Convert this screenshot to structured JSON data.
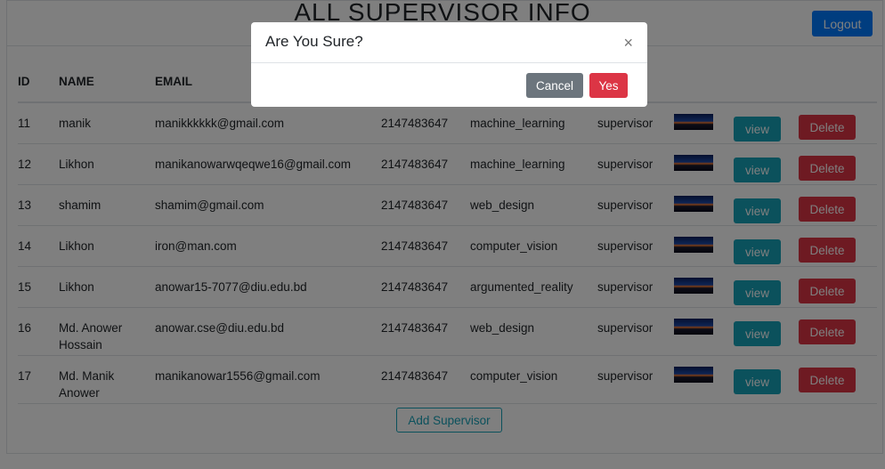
{
  "page": {
    "title": "ALL SUPERVISOR INFO",
    "logout_label": "Logout",
    "add_label": "Add Supervisor"
  },
  "table": {
    "headers": [
      "ID",
      "NAME",
      "EMAIL",
      "",
      "",
      "",
      "",
      "",
      ""
    ],
    "rows": [
      {
        "id": "11",
        "name": "manik",
        "email": "manikkkkkk@gmail.com",
        "phone": "2147483647",
        "area": "machine_learning",
        "role": "supervisor",
        "view": "view",
        "delete": "Delete"
      },
      {
        "id": "12",
        "name": "Likhon",
        "email": "manikanowarwqeqwe16@gmail.com",
        "phone": "2147483647",
        "area": "machine_learning",
        "role": "supervisor",
        "view": "view",
        "delete": "Delete"
      },
      {
        "id": "13",
        "name": "shamim",
        "email": "shamim@gmail.com",
        "phone": "2147483647",
        "area": "web_design",
        "role": "supervisor",
        "view": "view",
        "delete": "Delete"
      },
      {
        "id": "14",
        "name": "Likhon",
        "email": "iron@man.com",
        "phone": "2147483647",
        "area": "computer_vision",
        "role": "supervisor",
        "view": "view",
        "delete": "Delete"
      },
      {
        "id": "15",
        "name": "Likhon",
        "email": "anowar15-7077@diu.edu.bd",
        "phone": "2147483647",
        "area": "argumented_reality",
        "role": "supervisor",
        "view": "view",
        "delete": "Delete"
      },
      {
        "id": "16",
        "name": "Md. Anower Hossain",
        "email": "anowar.cse@diu.edu.bd",
        "phone": "2147483647",
        "area": "web_design",
        "role": "supervisor",
        "view": "view",
        "delete": "Delete"
      },
      {
        "id": "17",
        "name": "Md. Manik Anower",
        "email": "manikanowar1556@gmail.com",
        "phone": "2147483647",
        "area": "computer_vision",
        "role": "supervisor",
        "view": "view",
        "delete": "Delete"
      }
    ]
  },
  "modal": {
    "title": "Are You Sure?",
    "close_glyph": "×",
    "cancel_label": "Cancel",
    "yes_label": "Yes"
  },
  "colors": {
    "primary": "#007bff",
    "info": "#17a2b8",
    "danger": "#dc3545",
    "secondary": "#6c757d",
    "backdrop": "rgba(0,0,0,0.5)"
  },
  "icons": {
    "close": "close-icon",
    "thumbnail": "profile-image"
  }
}
